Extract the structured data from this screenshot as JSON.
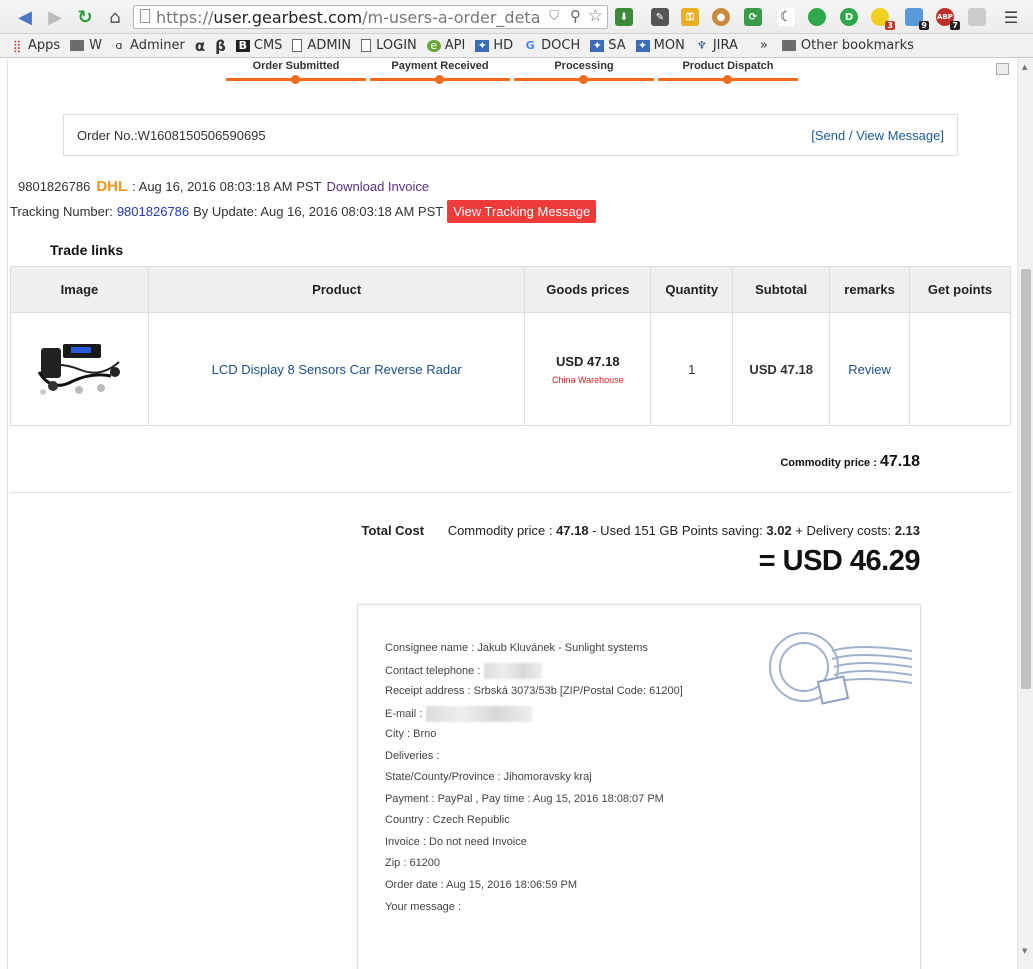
{
  "browser": {
    "url_prefix": "https://",
    "url_domain": "user.gearbest.com",
    "url_path": "/m-users-a-order_deta",
    "bookmarks": [
      {
        "label": "Apps",
        "icon": "apps-grid-icon"
      },
      {
        "label": "W",
        "icon": "folder-icon"
      },
      {
        "label": "Adminer",
        "icon": "adminer-icon"
      },
      {
        "label": "α",
        "icon": "none"
      },
      {
        "label": "β",
        "icon": "none"
      },
      {
        "label": "CMS",
        "icon": "b-icon"
      },
      {
        "label": "ADMIN",
        "icon": "page-icon"
      },
      {
        "label": "LOGIN",
        "icon": "page-icon"
      },
      {
        "label": "API",
        "icon": "globe-icon"
      },
      {
        "label": "HD",
        "icon": "jira-icon"
      },
      {
        "label": "DOCH",
        "icon": "google-icon"
      },
      {
        "label": "SA",
        "icon": "jira-icon"
      },
      {
        "label": "MON",
        "icon": "jira-icon"
      },
      {
        "label": "JIRA",
        "icon": "jira-icon"
      }
    ],
    "more_chevron": "»",
    "other_bookmarks": "Other bookmarks",
    "badges": {
      "ext1": "3",
      "ext2": "9",
      "abp": "7"
    },
    "abp_label": "ABP"
  },
  "steps": [
    "Order Submitted",
    "Payment Received",
    "Processing",
    "Product Dispatch"
  ],
  "order": {
    "number_label": "Order No.:W1608150506590695",
    "message_link": "[Send / View Message]"
  },
  "shipping": {
    "tracking_no": "9801826786",
    "carrier": "DHL",
    "date_text": ": Aug 16, 2016 08:03:18 AM PST",
    "invoice_link": "Download Invoice",
    "tracking_label": "Tracking Number:",
    "tracking_link": "9801826786",
    "update_text": "By Update: Aug 16, 2016 08:03:18 AM PST",
    "view_tracking": "View Tracking Message"
  },
  "trade_links_title": "Trade links",
  "table": {
    "headers": [
      "Image",
      "Product",
      "Goods prices",
      "Quantity",
      "Subtotal",
      "remarks",
      "Get points"
    ],
    "row": {
      "product": "LCD Display 8 Sensors Car Reverse Radar",
      "price": "USD 47.18",
      "warehouse": "China Warehouse",
      "quantity": "1",
      "subtotal": "USD 47.18",
      "remarks": "Review",
      "points": ""
    }
  },
  "commodity": {
    "label": "Commodity price :",
    "value": "47.18"
  },
  "totals": {
    "title": "Total Cost",
    "commodity_label": "Commodity price :",
    "commodity_value": "47.18",
    "points_label": "- Used 151 GB Points saving:",
    "points_value": "3.02",
    "delivery_label": "+ Delivery costs:",
    "delivery_value": "2.13",
    "grand_total": "= USD 46.29"
  },
  "address": {
    "lines": [
      "Consignee name : Jakub Kluvánek - Sunlight systems",
      "Contact telephone :",
      "Receipt address : Srbská 3073/53b [ZIP/Postal Code: 61200]",
      "E-mail :",
      "City : Brno",
      "Deliveries :",
      "State/County/Province : Jihomoravsky kraj",
      "Payment : PayPal , Pay time : Aug 15, 2016 18:08:07 PM",
      "Country : Czech Republic",
      "Invoice : Do not need Invoice",
      "Zip : 61200",
      "Order date : Aug 15, 2016 18:06:59 PM",
      "Your message :"
    ]
  },
  "colors": {
    "accent": "#f26a1b",
    "dhl": "#f7941d",
    "red_button": "#ef3a3a",
    "link": "#1a4f8a"
  }
}
